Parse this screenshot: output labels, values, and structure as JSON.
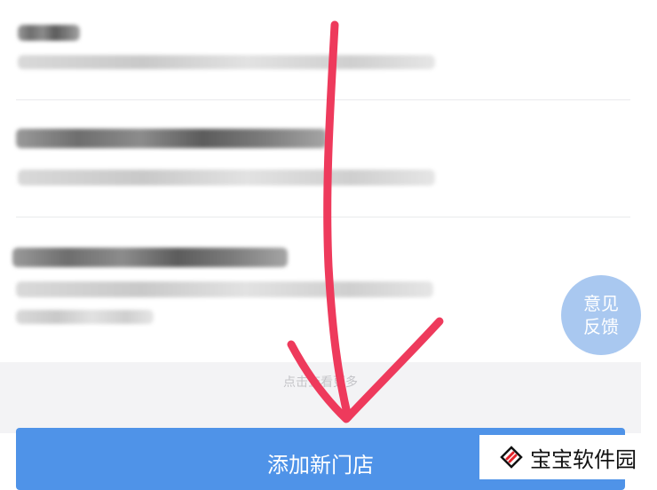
{
  "load_more": {
    "label": "点击查看更多"
  },
  "feedback": {
    "line1": "意见",
    "line2": "反馈"
  },
  "footer": {
    "add_store_label": "添加新门店"
  },
  "watermark": {
    "text": "宝宝软件园",
    "icon": "diamond-logo-icon"
  },
  "colors": {
    "primary": "#4f93e8",
    "feedback_bg": "#a9c8f0",
    "arrow": "#ee3a5c"
  }
}
